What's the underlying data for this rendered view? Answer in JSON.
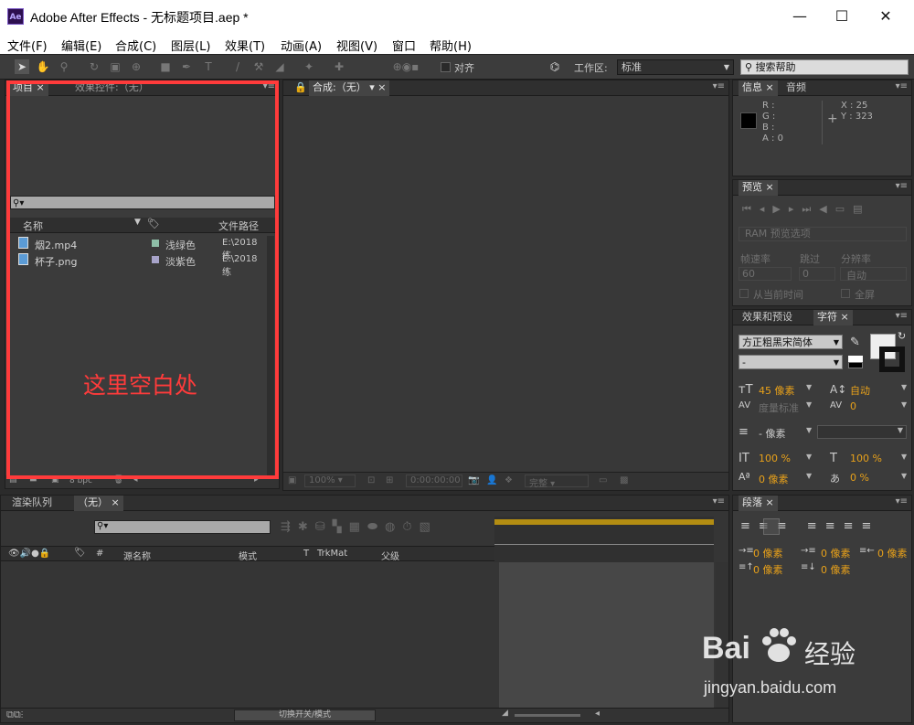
{
  "window": {
    "app_icon": "Ae",
    "title": "Adobe After Effects - 无标题项目.aep *",
    "min": "—",
    "max": "☐",
    "close": "✕"
  },
  "menu": [
    "文件(F)",
    "编辑(E)",
    "合成(C)",
    "图层(L)",
    "效果(T)",
    "动画(A)",
    "视图(V)",
    "窗口",
    "帮助(H)"
  ],
  "toolbar": {
    "align_label": "对齐",
    "workspace_label": "工作区:",
    "workspace_value": "标准",
    "search_help": "搜索帮助"
  },
  "project_panel": {
    "tabs": [
      "项目",
      "效果控件:（无）"
    ],
    "columns": [
      "名称",
      "文件路径"
    ],
    "files": [
      {
        "name": "烟2.mp4",
        "label": "浅绿色",
        "label_color": "#8fbfa8",
        "path": "E:\\2018练"
      },
      {
        "name": "杯子.png",
        "label": "淡紫色",
        "label_color": "#a7a3c9",
        "path": "E:\\2018练"
      }
    ],
    "footer_bpc": "8 bpc"
  },
  "annotation": {
    "text": "这里空白处",
    "color": "#ff3b3b"
  },
  "comp_panel": {
    "tab": "合成:（无）",
    "zoom": "100%",
    "timecode": "0:00:00:00",
    "quality": "完整"
  },
  "info_panel": {
    "tabs": [
      "信息",
      "音频"
    ],
    "r": "R :",
    "g": "G :",
    "b": "B :",
    "a": "A : 0",
    "x": "X : 25",
    "y": "Y : 323"
  },
  "preview_panel": {
    "tab": "预览",
    "ram_options": "RAM 预览选项",
    "framerate": "帧速率",
    "skip": "跳过",
    "resolution": "分辨率",
    "fr_val": "60",
    "skip_val": "0",
    "res_val": "自动",
    "from_current": "从当前时间",
    "fullscreen": "全屏"
  },
  "char_panel": {
    "tabs": [
      "效果和预设",
      "字符"
    ],
    "font": "方正粗黑宋简体",
    "style": "-",
    "size": "45 像素",
    "leading": "自动",
    "kerning": "度量标准",
    "tracking": "0",
    "stroke": "- 像素",
    "vscale": "100 %",
    "hscale": "100 %",
    "baseline": "0 像素",
    "tsume": "0 %"
  },
  "para_panel": {
    "tab": "段落",
    "indent1": "0 像素",
    "indent2": "0 像素",
    "indent3": "0 像素",
    "space1": "0 像素",
    "space2": "0 像素"
  },
  "render_panel": {
    "tabs": [
      "渲染队列",
      "（无）"
    ],
    "columns": [
      "#",
      "源名称",
      "模式",
      "T",
      "TrkMat",
      "父级"
    ],
    "toggle_label": "切换开关/模式"
  },
  "watermark": {
    "brand": "Bai",
    "brand2": "经验",
    "url": "jingyan.baidu.com"
  }
}
